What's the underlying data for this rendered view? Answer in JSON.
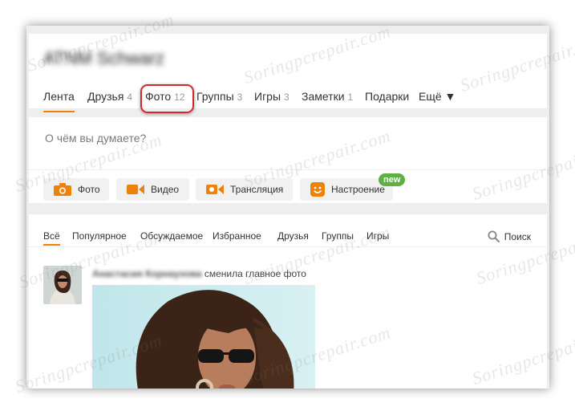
{
  "watermark": "Soringpcrepair.com",
  "profile": {
    "name": "ATNM Schwarz"
  },
  "nav": {
    "items": [
      {
        "label": "Лента",
        "count": ""
      },
      {
        "label": "Друзья",
        "count": "4"
      },
      {
        "label": "Фото",
        "count": "12"
      },
      {
        "label": "Группы",
        "count": "3"
      },
      {
        "label": "Игры",
        "count": "3"
      },
      {
        "label": "Заметки",
        "count": "1"
      },
      {
        "label": "Подарки",
        "count": ""
      },
      {
        "label": "Ещё ▼",
        "count": ""
      }
    ]
  },
  "post": {
    "placeholder": "О чём вы думаете?",
    "buttons": [
      {
        "label": "Фото",
        "icon": "camera-icon"
      },
      {
        "label": "Видео",
        "icon": "video-camera-icon"
      },
      {
        "label": "Трансляция",
        "icon": "broadcast-icon"
      },
      {
        "label": "Настроение",
        "icon": "smiley-icon"
      }
    ],
    "new_badge": "new"
  },
  "feed": {
    "filters": [
      "Всё",
      "Популярное",
      "Обсуждаемое",
      "Избранное",
      "Друзья",
      "Группы",
      "Игры"
    ],
    "search_label": "Поиск",
    "item": {
      "author": "Анастасия Корнаухова",
      "action": "сменила главное фото"
    }
  },
  "colors": {
    "accent": "#ee8208",
    "badge": "#5fb044",
    "highlight": "#d4282c"
  }
}
